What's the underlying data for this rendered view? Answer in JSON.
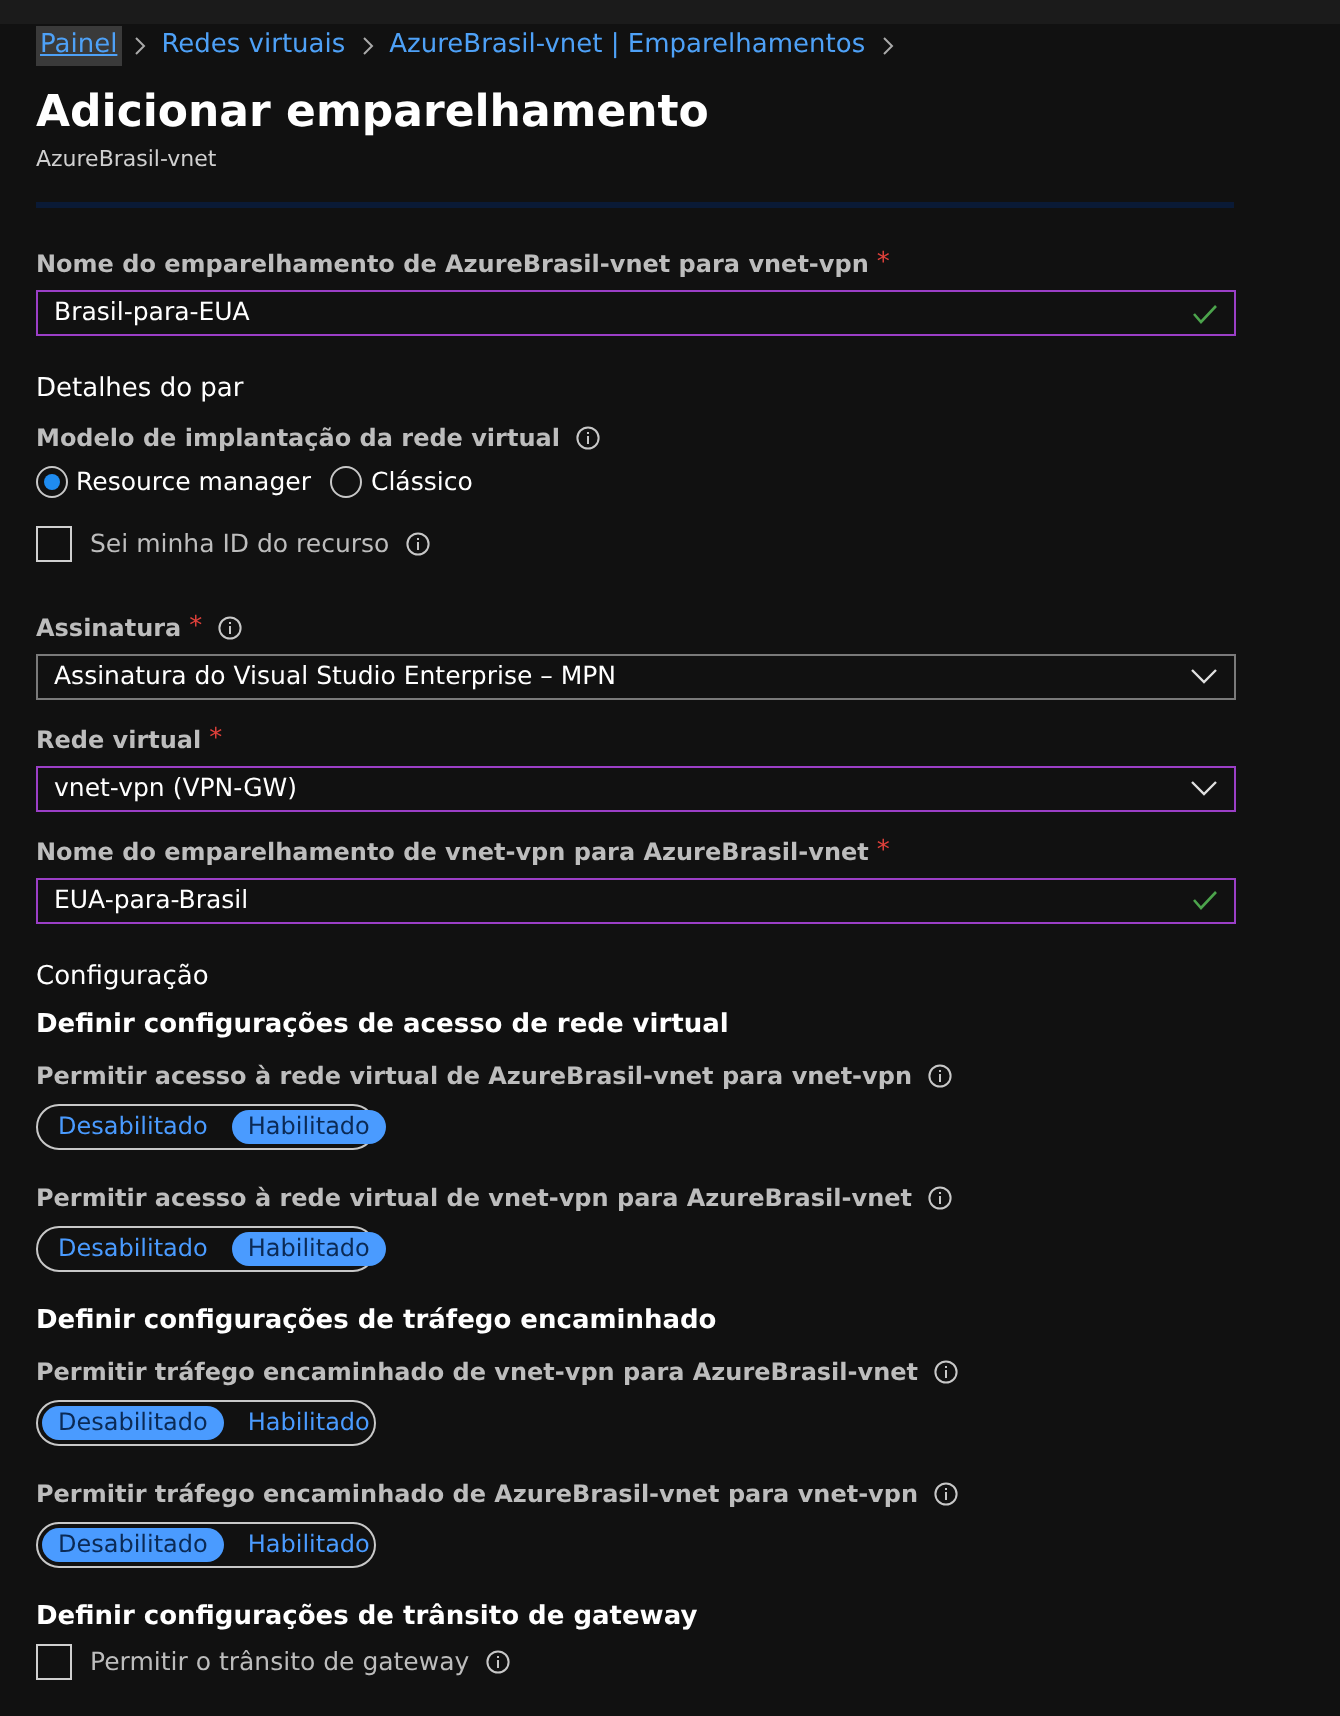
{
  "breadcrumb": [
    {
      "label": "Painel",
      "focused": true
    },
    {
      "label": "Redes virtuais",
      "focused": false
    },
    {
      "label": "AzureBrasil-vnet | Emparelhamentos",
      "focused": false
    }
  ],
  "title": "Adicionar emparelhamento",
  "subtitle": "AzureBrasil-vnet",
  "items": [
    {
      "kind": "text_input",
      "label": "Nome do emparelhamento de AzureBrasil-vnet para vnet-vpn",
      "required": "*",
      "value": "Brasil-para-EUA",
      "valid": true,
      "highlighted": true
    },
    {
      "kind": "heading",
      "text": "Detalhes do par"
    },
    {
      "kind": "radio_group",
      "label": "Modelo de implantação da rede virtual",
      "info": true,
      "options": [
        {
          "label": "Resource manager",
          "selected": true
        },
        {
          "label": "Clássico",
          "selected": false
        }
      ]
    },
    {
      "kind": "checkbox",
      "label": "Sei minha ID do recurso",
      "info": true,
      "checked": false
    },
    {
      "kind": "dropdown",
      "label": "Assinatura",
      "required": "*",
      "info": true,
      "value": "Assinatura do Visual Studio Enterprise – MPN",
      "highlighted": false
    },
    {
      "kind": "dropdown",
      "label": "Rede virtual",
      "required": "*",
      "value": "vnet-vpn (VPN-GW)",
      "highlighted": true
    },
    {
      "kind": "text_input",
      "label": "Nome do emparelhamento de vnet-vpn para AzureBrasil-vnet",
      "required": "*",
      "value": "EUA-para-Brasil",
      "valid": true,
      "highlighted": true
    },
    {
      "kind": "heading",
      "text": "Configuração"
    },
    {
      "kind": "subheading",
      "text": "Definir configurações de acesso de rede virtual"
    },
    {
      "kind": "toggle",
      "label": "Permitir acesso à rede virtual de AzureBrasil-vnet para vnet-vpn",
      "info": true,
      "options": [
        {
          "label": "Desabilitado",
          "selected": false
        },
        {
          "label": "Habilitado",
          "selected": true
        }
      ]
    },
    {
      "kind": "toggle",
      "label": "Permitir acesso à rede virtual de vnet-vpn para AzureBrasil-vnet",
      "info": true,
      "options": [
        {
          "label": "Desabilitado",
          "selected": false
        },
        {
          "label": "Habilitado",
          "selected": true
        }
      ]
    },
    {
      "kind": "subheading",
      "text": "Definir configurações de tráfego encaminhado"
    },
    {
      "kind": "toggle",
      "label": "Permitir tráfego encaminhado de vnet-vpn para AzureBrasil-vnet",
      "info": true,
      "options": [
        {
          "label": "Desabilitado",
          "selected": true
        },
        {
          "label": "Habilitado",
          "selected": false
        }
      ]
    },
    {
      "kind": "toggle",
      "label": "Permitir tráfego encaminhado de AzureBrasil-vnet para vnet-vpn",
      "info": true,
      "options": [
        {
          "label": "Desabilitado",
          "selected": true
        },
        {
          "label": "Habilitado",
          "selected": false
        }
      ]
    },
    {
      "kind": "subheading",
      "text": "Definir configurações de trânsito de gateway"
    },
    {
      "kind": "checkbox",
      "label": "Permitir o trânsito de gateway",
      "info": true,
      "checked": false
    }
  ]
}
